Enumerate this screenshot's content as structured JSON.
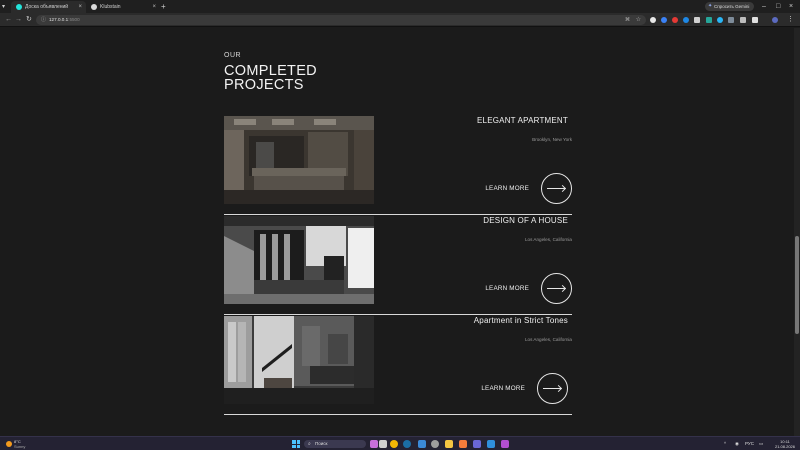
{
  "browser": {
    "tabs": [
      {
        "title": "Доска объявлений OLX.ua, р",
        "favicon_color": "#23e5db",
        "active": true
      },
      {
        "title": "Klubstain",
        "favicon_color": "#d9d9d9",
        "active": false
      }
    ],
    "new_tab_icon": "plus-icon",
    "gemini_label": "Спросить Gemini",
    "address": {
      "host": "127.0.0.1",
      "port": ":5500"
    }
  },
  "page": {
    "eyebrow": "OUR",
    "title": "COMPLETED PROJECTS",
    "projects": [
      {
        "title": "ELEGANT APARTMENT",
        "location": "Brooklyn, New York",
        "cta": "LEARN MORE"
      },
      {
        "title": "DESIGN OF A HOUSE",
        "location": "Los Angeles, California",
        "cta": "LEARN MORE"
      },
      {
        "title": "Apartment in Strict Tones",
        "location": "Los Angeles, California",
        "cta": "LEARN MORE"
      }
    ]
  },
  "taskbar": {
    "weather": {
      "temp": "8°C",
      "condition": "Sunny"
    },
    "search_placeholder": "Поиск",
    "language": "РУС",
    "time": "10:11",
    "date": "21.08.2026"
  },
  "colors": {
    "page_bg": "#1b1b1b",
    "accent_tab": "#23e5db",
    "windows_blue": "#4cc2ff"
  }
}
